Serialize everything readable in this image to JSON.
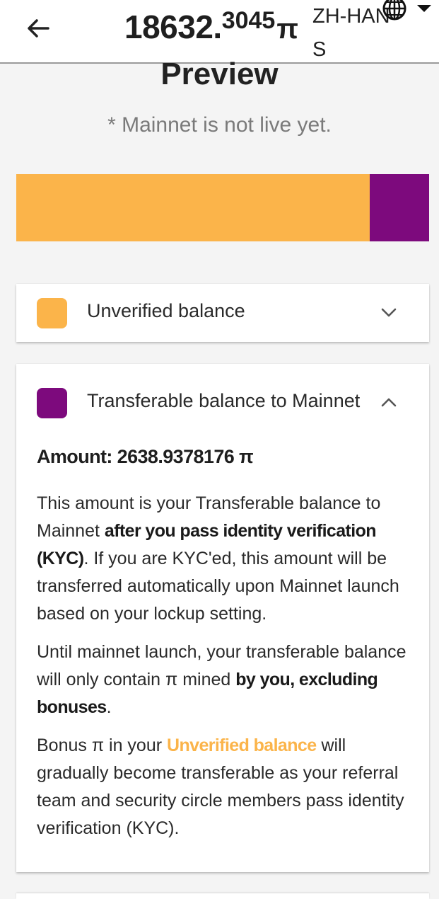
{
  "header": {
    "balance_int": "18632.",
    "balance_dec": "3045",
    "balance_unit": "π",
    "language_code": "ZH-HANS",
    "back_icon": "arrow-left-icon",
    "language_icon": "globe-icon"
  },
  "preview": {
    "title": "Preview",
    "note": "* Mainnet is not live yet."
  },
  "balance_bar": {
    "unverified_fraction": 0.857,
    "transferable_fraction": 0.143
  },
  "colors": {
    "unverified": "#fbb44a",
    "transferable": "#7d0a7d"
  },
  "unverified_card": {
    "label": "Unverified balance",
    "expanded": false
  },
  "transferable_card": {
    "label": "Transferable balance to Mainnet",
    "expanded": true,
    "amount": "Amount: 2638.9378176 π",
    "p1": {
      "a": "This amount is your Transferable balance to Mainnet ",
      "b": "after you pass identity verification (KYC)",
      "c": ". If you are KYC'ed, this amount will be transferred automatically upon Mainnet launch based on your lockup setting."
    },
    "p2": {
      "a": "Until mainnet launch, your transferable balance will only contain π mined ",
      "b": "by you, excluding bonuses",
      "c": "."
    },
    "p3": {
      "a": "Bonus π in your ",
      "link": "Unverified balance",
      "b": " will gradually become transferable as your referral team and security circle members pass identity verification (KYC)."
    }
  }
}
